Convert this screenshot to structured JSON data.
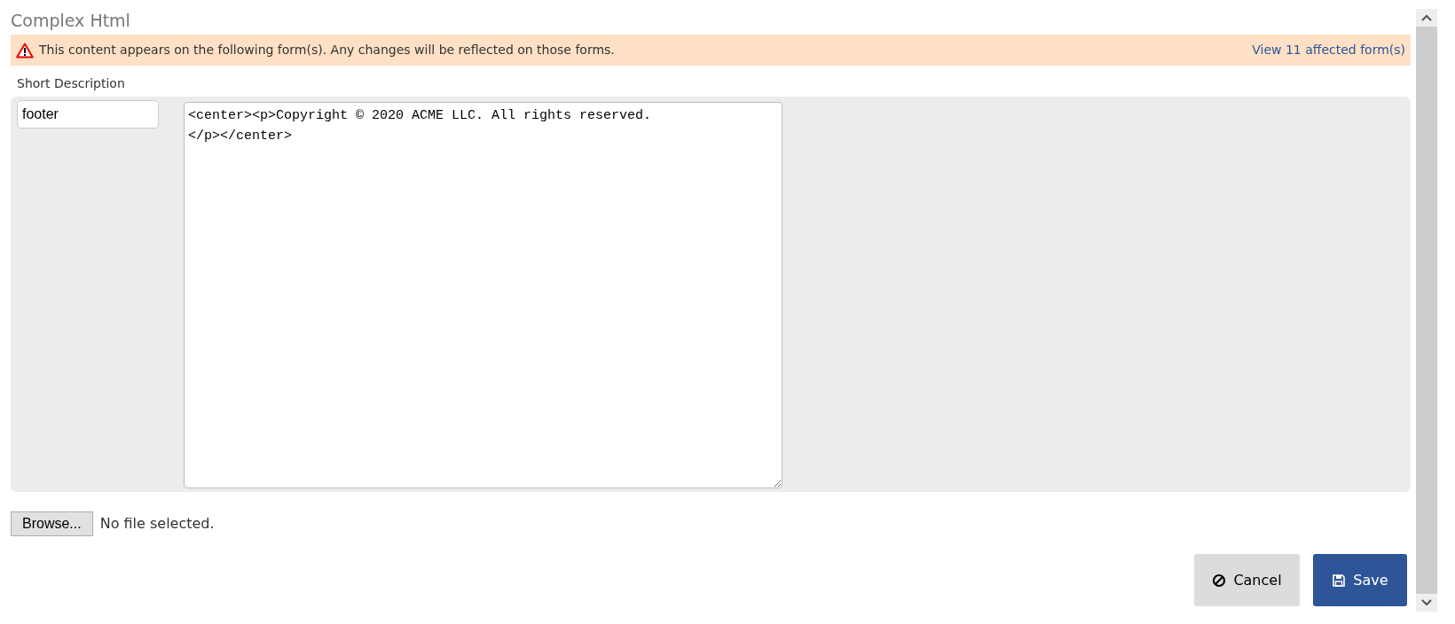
{
  "title": "Complex Html",
  "alert": {
    "message": "This content appears on the following form(s). Any changes will be reflected on those forms.",
    "link": "View 11 affected form(s)"
  },
  "short_description": {
    "label": "Short Description",
    "value": "footer"
  },
  "editor": {
    "value": "<center><p>Copyright © 2020 ACME LLC. All rights reserved.\n</p></center>"
  },
  "file": {
    "button": "Browse...",
    "status": "No file selected."
  },
  "buttons": [
    {
      "kind": "cancel",
      "label": "Cancel"
    },
    {
      "kind": "save",
      "label": "Save"
    }
  ]
}
